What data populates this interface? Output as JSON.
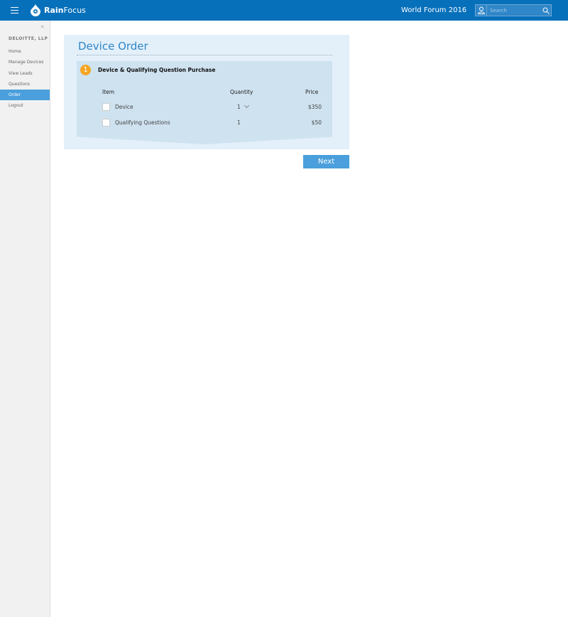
{
  "header": {
    "brand_bold": "Rain",
    "brand_light": "Focus",
    "event": "World Forum 2016",
    "search_placeholder": "Search"
  },
  "sidebar": {
    "company": "DELOITTE, LLP",
    "items": [
      {
        "label": "Home"
      },
      {
        "label": "Manage Devices"
      },
      {
        "label": "View Leads"
      },
      {
        "label": "Questions"
      },
      {
        "label": "Order"
      },
      {
        "label": "Logout"
      }
    ],
    "active": "Order"
  },
  "main": {
    "title": "Device Order",
    "step": {
      "number": "1",
      "title": "Device & Qualifying Question Purchase"
    },
    "columns": {
      "item": "Item",
      "quantity": "Quantity",
      "price": "Price"
    },
    "rows": [
      {
        "item": "Device",
        "quantity": "1",
        "price": "$350"
      },
      {
        "item": "Qualifying Questions",
        "quantity": "1",
        "price": "$50"
      }
    ],
    "next_label": "Next"
  }
}
